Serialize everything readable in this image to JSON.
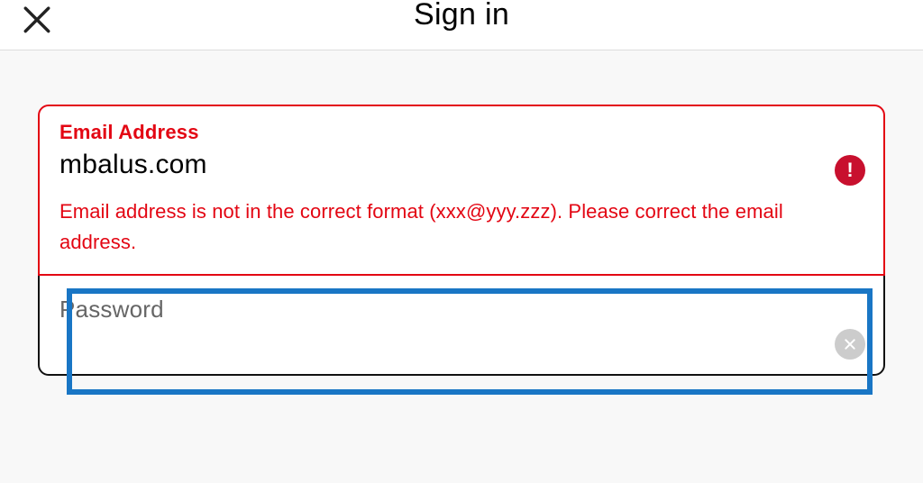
{
  "header": {
    "title": "Sign in"
  },
  "form": {
    "email": {
      "label": "Email Address",
      "value": "mbalus.com",
      "error": "Email address is not in the correct format (xxx@yyy.zzz). Please correct the email address."
    },
    "password": {
      "label": "Password",
      "value": ""
    }
  },
  "colors": {
    "error": "#e30613",
    "highlight": "#1976c5"
  }
}
